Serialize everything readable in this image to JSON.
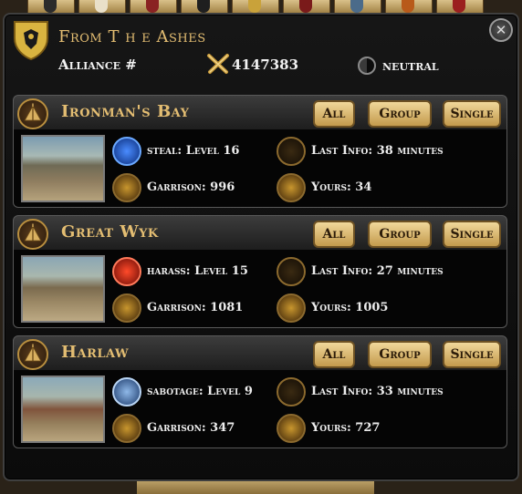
{
  "colors": {
    "gold_text": "#e3bd72",
    "button_gold": "#d9b66a",
    "panel_bg": "#0b0b0b"
  },
  "header": {
    "title": "From T h e Ashes",
    "alliance_label": "Alliance #",
    "power_value": "4147383",
    "stance": "neutral",
    "close_icon": "close-icon"
  },
  "buttons": {
    "all": "All",
    "group": "Group",
    "single": "Single"
  },
  "targets": [
    {
      "name": "Ironman's Bay",
      "action": "steal: Level 16",
      "action_icon": "steal-icon",
      "last_info": "Last Info: 38 minutes",
      "garrison": "Garrison: 996",
      "yours": "Yours: 34"
    },
    {
      "name": "Great Wyk",
      "action": "harass: Level 15",
      "action_icon": "harass-icon",
      "last_info": "Last Info: 27 minutes",
      "garrison": "Garrison: 1081",
      "yours": "Yours: 1005"
    },
    {
      "name": "Harlaw",
      "action": "sabotage: Level 9",
      "action_icon": "sabotage-icon",
      "last_info": "Last Info: 33 minutes",
      "garrison": "Garrison: 347",
      "yours": "Yours: 727"
    }
  ]
}
